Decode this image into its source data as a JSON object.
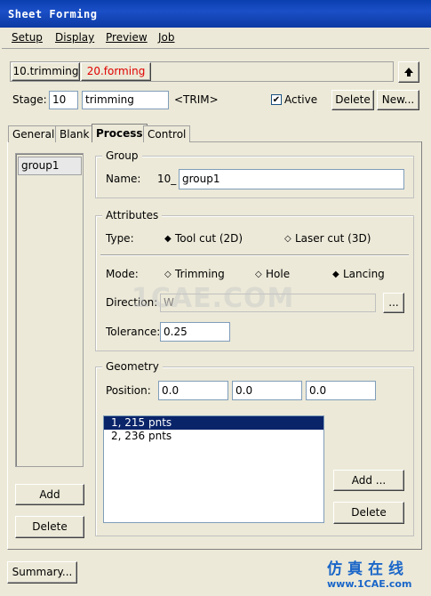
{
  "window": {
    "title": "Sheet Forming"
  },
  "menu": [
    "Setup",
    "Display",
    "Preview",
    "Job"
  ],
  "stages": {
    "tabs": [
      "10.trimming",
      "20.forming"
    ],
    "active_color": "#e00000",
    "up_icon": "up-arrow-icon"
  },
  "stage_row": {
    "label": "Stage:",
    "number": "10",
    "name": "trimming",
    "tag": "<TRIM>",
    "active_label": "Active",
    "active_checked": true,
    "delete": "Delete",
    "new": "New..."
  },
  "tabs": [
    "General",
    "Blank",
    "Process",
    "Control"
  ],
  "selected_tab": "Process",
  "group_list": {
    "items": [
      "group1"
    ],
    "add": "Add",
    "delete": "Delete"
  },
  "group": {
    "legend": "Group",
    "name_label": "Name:",
    "prefix": "10_",
    "name_value": "group1"
  },
  "attributes": {
    "legend": "Attributes",
    "type_label": "Type:",
    "type_options": [
      {
        "label": "Tool cut (2D)",
        "selected": true
      },
      {
        "label": "Laser cut (3D)",
        "selected": false
      }
    ],
    "mode_label": "Mode:",
    "mode_options": [
      {
        "label": "Trimming",
        "selected": false
      },
      {
        "label": "Hole",
        "selected": false
      },
      {
        "label": "Lancing",
        "selected": true
      }
    ],
    "direction_label": "Direction:",
    "direction_value": "W",
    "browse": "...",
    "tolerance_label": "Tolerance:",
    "tolerance_value": "0.25"
  },
  "geometry": {
    "legend": "Geometry",
    "position_label": "Position:",
    "position": [
      "0.0",
      "0.0",
      "0.0"
    ],
    "items": [
      "1,  215 pnts",
      "2,  236 pnts"
    ],
    "selected_index": 0,
    "add": "Add ...",
    "delete": "Delete"
  },
  "footer": {
    "summary": "Summary...",
    "watermark_text": "1CAE.COM",
    "logo_cn": "仿真在线",
    "logo_url": "www.1CAE.com"
  }
}
